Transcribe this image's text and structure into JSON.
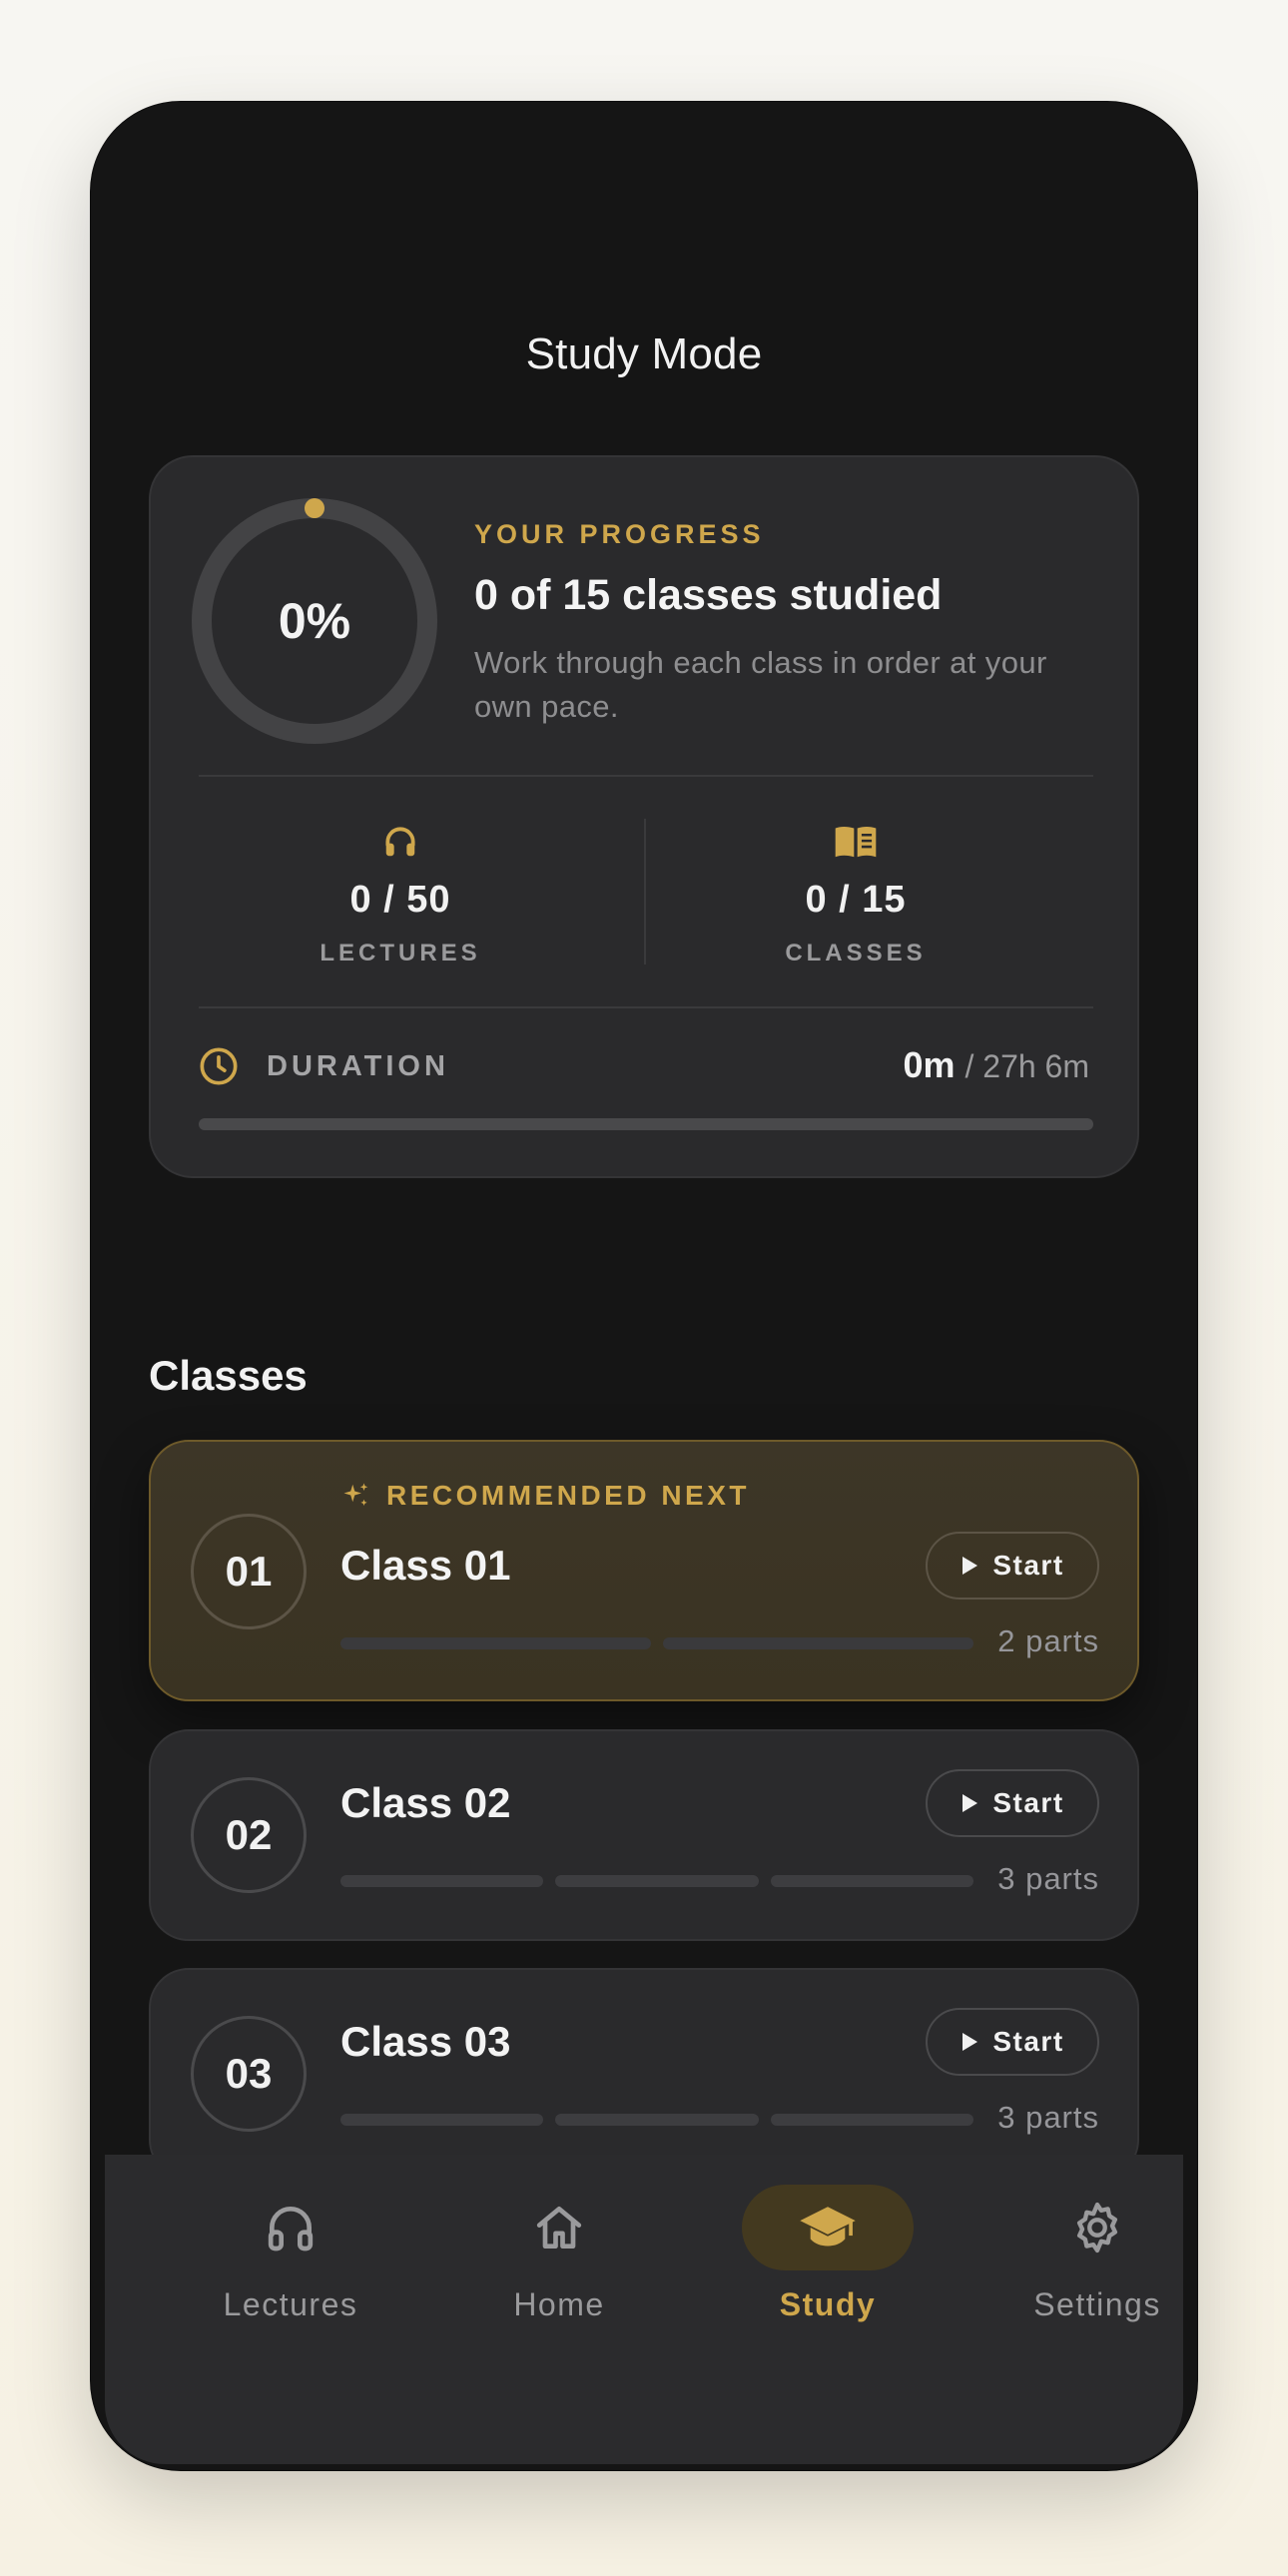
{
  "header": {
    "title": "Study Mode"
  },
  "progress": {
    "percent_label": "0%",
    "percent_value": 0,
    "kicker": "YOUR PROGRESS",
    "heading": "0 of 15 classes studied",
    "subtitle": "Work through each class in order at your own pace.",
    "stats": [
      {
        "icon": "headphones-icon",
        "value": "0 / 50",
        "label": "LECTURES"
      },
      {
        "icon": "book-icon",
        "value": "0 / 15",
        "label": "CLASSES"
      }
    ],
    "duration": {
      "label": "DURATION",
      "current": "0m",
      "total": "/ 27h 6m",
      "fraction": 0
    }
  },
  "classes_section": {
    "title": "Classes",
    "recommended_label": "RECOMMENDED NEXT",
    "items": [
      {
        "number": "01",
        "name": "Class 01",
        "parts_label": "2 parts",
        "parts": 2,
        "button": "Start",
        "recommended": true
      },
      {
        "number": "02",
        "name": "Class 02",
        "parts_label": "3 parts",
        "parts": 3,
        "button": "Start",
        "recommended": false
      },
      {
        "number": "03",
        "name": "Class 03",
        "parts_label": "3 parts",
        "parts": 3,
        "button": "Start",
        "recommended": false
      }
    ]
  },
  "tabbar": {
    "tabs": [
      {
        "label": "Lectures",
        "icon": "headphones-icon",
        "active": false
      },
      {
        "label": "Home",
        "icon": "home-icon",
        "active": false
      },
      {
        "label": "Study",
        "icon": "graduation-cap-icon",
        "active": true
      },
      {
        "label": "Settings",
        "icon": "gear-icon",
        "active": false
      }
    ]
  },
  "colors": {
    "accent": "#cfa74c",
    "background": "#151515",
    "card": "#2a2a2c",
    "featured_card": "#3d3627"
  }
}
